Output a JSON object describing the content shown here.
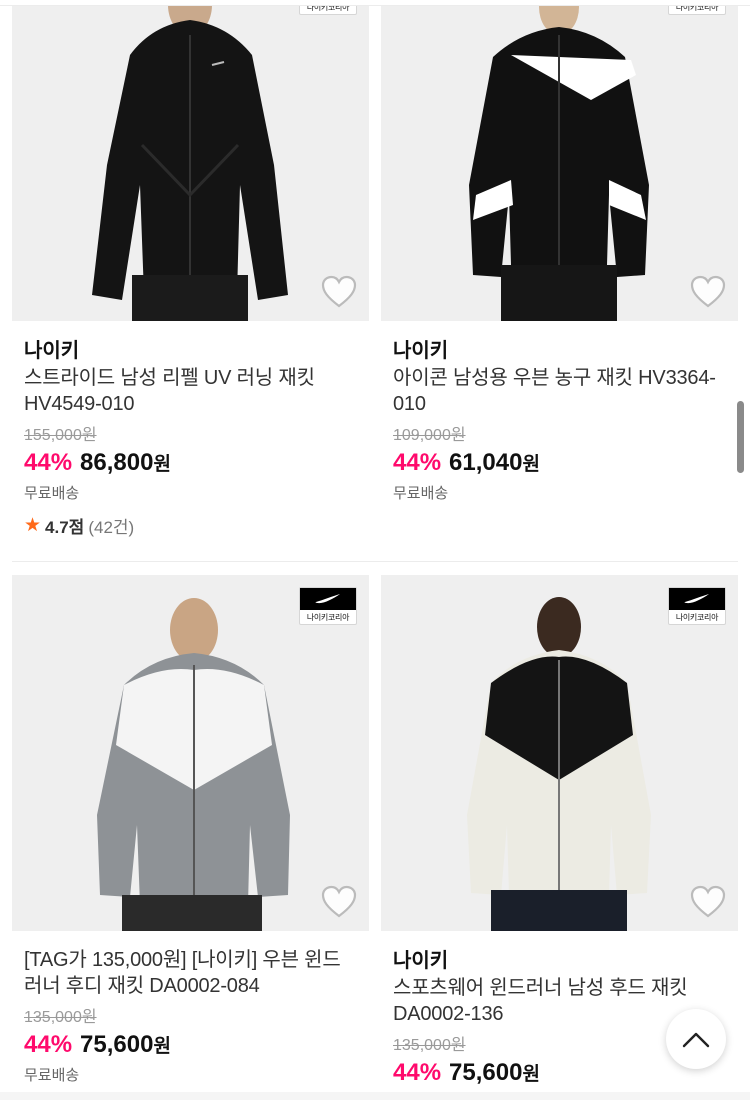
{
  "products": [
    {
      "brand": "나이키",
      "name": "스트라이드 남성 리펠 UV 러닝 재킷 HV4549-010",
      "original_price": "155,000원",
      "discount": "44%",
      "price": "86,800",
      "currency": "원",
      "shipping": "무료배송",
      "rating": {
        "score": "4.7점",
        "count": "(42건)"
      },
      "badge_label": "나이키코리아",
      "image_icon": "black-running-jacket-image"
    },
    {
      "brand": "나이키",
      "name": "아이콘 남성용 우븐 농구 재킷 HV3364-010",
      "original_price": "109,000원",
      "discount": "44%",
      "price": "61,040",
      "currency": "원",
      "shipping": "무료배송",
      "badge_label": "나이키코리아",
      "image_icon": "black-white-basketball-jacket-image"
    },
    {
      "brand": "",
      "name": "[TAG가 135,000원] [나이키] 우븐 윈드러너 후디 재킷 DA0002-084",
      "original_price": "135,000원",
      "discount": "44%",
      "price": "75,600",
      "currency": "원",
      "shipping": "무료배송",
      "badge_label": "나이키코리아",
      "image_icon": "grey-white-windrunner-image"
    },
    {
      "brand": "나이키",
      "name": "스포츠웨어 윈드러너 남성 후드 재킷 DA0002-136",
      "original_price": "135,000원",
      "discount": "44%",
      "price": "75,600",
      "currency": "원",
      "badge_label": "나이키코리아",
      "image_icon": "black-cream-windrunner-image"
    }
  ],
  "colors": {
    "discount": "#ff0a6c",
    "star": "#ff6a1a",
    "heart_fill": "#ffffff",
    "heart_stroke": "#bbbbbb"
  },
  "icons": {
    "wishlist": "heart-icon",
    "scroll_top": "chevron-up-icon",
    "rating": "star-icon"
  }
}
